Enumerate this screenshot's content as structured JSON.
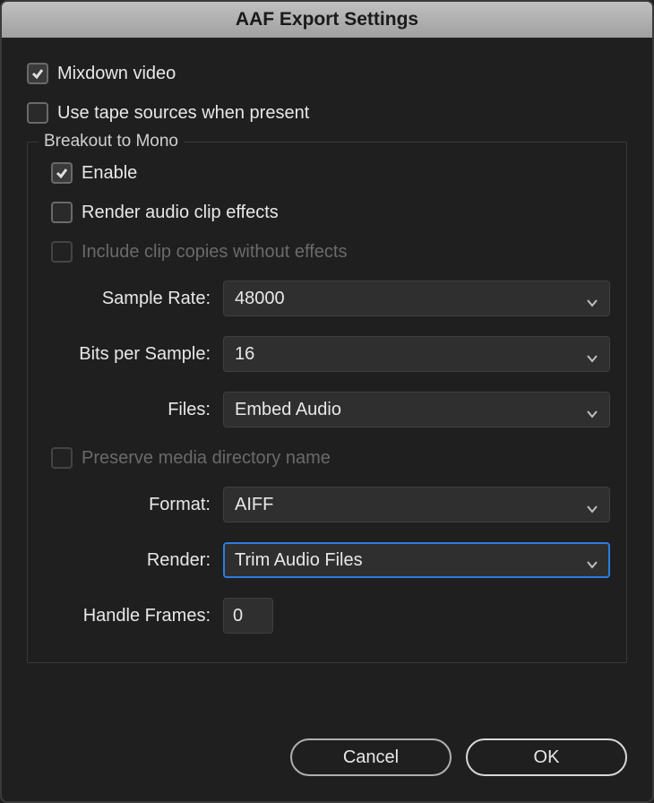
{
  "titlebar": {
    "title": "AAF Export Settings"
  },
  "options": {
    "mixdown_video": {
      "label": "Mixdown video",
      "checked": true
    },
    "use_tape_sources": {
      "label": "Use tape sources when present",
      "checked": false
    }
  },
  "breakout": {
    "legend": "Breakout to Mono",
    "enable": {
      "label": "Enable",
      "checked": true
    },
    "render_effects": {
      "label": "Render audio clip effects",
      "checked": false
    },
    "include_copies": {
      "label": "Include clip copies without effects",
      "checked": false,
      "disabled": true
    },
    "sample_rate": {
      "label": "Sample Rate:",
      "value": "48000"
    },
    "bits_per_sample": {
      "label": "Bits per Sample:",
      "value": "16"
    },
    "files": {
      "label": "Files:",
      "value": "Embed Audio"
    },
    "preserve_dir": {
      "label": "Preserve media directory name",
      "checked": false,
      "disabled": true
    },
    "format": {
      "label": "Format:",
      "value": "AIFF"
    },
    "render": {
      "label": "Render:",
      "value": "Trim Audio Files"
    },
    "handle_frames": {
      "label": "Handle Frames:",
      "value": "0"
    }
  },
  "footer": {
    "cancel": "Cancel",
    "ok": "OK"
  }
}
